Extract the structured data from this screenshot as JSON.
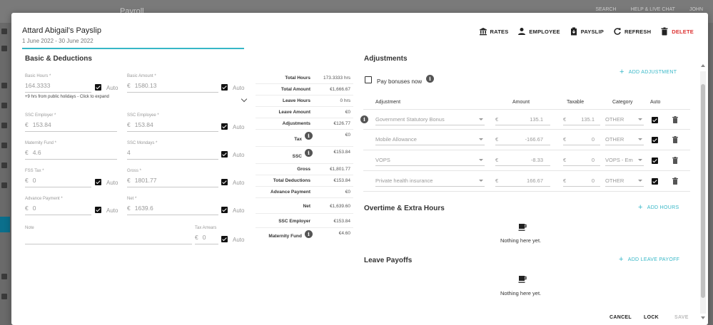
{
  "background": {
    "app_title": "Payroll",
    "top_right": [
      "SEARCH",
      "HELP & LIVE CHAT",
      "JOHN"
    ]
  },
  "header": {
    "title": "Attard Abigail's Payslip",
    "dates": "1 June 2022 - 30 June 2022"
  },
  "actions": {
    "rates": "RATES",
    "employee": "EMPLOYEE",
    "payslip": "PAYSLIP",
    "refresh": "REFRESH",
    "delete": "DELETE"
  },
  "basic": {
    "section_title": "Basic & Deductions",
    "auto_label": "Auto",
    "currency": "€",
    "basic_hours": {
      "label": "Basic Hours *",
      "value": "164.3333"
    },
    "basic_amount": {
      "label": "Basic Amount *",
      "value": "1580.13"
    },
    "hint": "+9 hrs from public holidays - Click to expand",
    "ssc_employer": {
      "label": "SSC Employer *",
      "value": "153.84"
    },
    "ssc_employee": {
      "label": "SSC Employee *",
      "value": "153.84"
    },
    "maternity_fund": {
      "label": "Maternity Fund *",
      "value": "4.6"
    },
    "ssc_mondays": {
      "label": "SSC Mondays *",
      "value": "4"
    },
    "fss_tax": {
      "label": "FSS Tax *",
      "value": "0"
    },
    "gross": {
      "label": "Gross *",
      "value": "1801.77"
    },
    "advance_payment": {
      "label": "Advance Payment *",
      "value": "0"
    },
    "net": {
      "label": "Net *",
      "value": "1639.6"
    },
    "note": {
      "label": "Note",
      "value": ""
    },
    "tax_arrears": {
      "label": "Tax Arrears",
      "value": "0"
    }
  },
  "summary": [
    {
      "key": "Total Hours",
      "value": "173.3333 hrs"
    },
    {
      "key": "Total Amount",
      "value": "€1,666.67"
    },
    {
      "key": "Leave Hours",
      "value": "0 hrs"
    },
    {
      "key": "Leave Amount",
      "value": "€0"
    },
    {
      "key": "Adjustments",
      "value": "€126.77"
    },
    {
      "key": "Tax",
      "value": "€0"
    },
    {
      "key": "SSC",
      "value": "€153.84"
    },
    {
      "key": "Gross",
      "value": "€1,801.77"
    },
    {
      "key": "Total Deductions",
      "value": "€153.84"
    },
    {
      "key": "Advance Payment",
      "value": "€0"
    },
    {
      "key": "Net",
      "value": "€1,639.60"
    },
    {
      "key": "SSC Employer",
      "value": "€153.84"
    },
    {
      "key": "Maternity Fund",
      "value": "€4.60"
    }
  ],
  "adjustments": {
    "section_title": "Adjustments",
    "pay_bonuses_label": "Pay bonuses now",
    "add_label": "ADD ADJUSTMENT",
    "columns": {
      "adjustment": "Adjustment",
      "amount": "Amount",
      "taxable": "Taxable",
      "category": "Category",
      "auto": "Auto"
    },
    "currency": "€",
    "rows": [
      {
        "name": "Government Statutory Bonus",
        "amount": "135.1",
        "taxable": "135.1",
        "category": "OTHER"
      },
      {
        "name": "Mobile Allowance",
        "amount": "-166.67",
        "taxable": "0",
        "category": "OTHER"
      },
      {
        "name": "VOPS",
        "amount": "-8.33",
        "taxable": "0",
        "category": "VOPS - Em"
      },
      {
        "name": "Private health insurance",
        "amount": "166.67",
        "taxable": "0",
        "category": "OTHER"
      }
    ]
  },
  "overtime": {
    "section_title": "Overtime & Extra Hours",
    "add_label": "ADD HOURS",
    "empty": "Nothing here yet."
  },
  "leave_payoffs": {
    "section_title": "Leave Payoffs",
    "add_label": "ADD LEAVE PAYOFF",
    "empty": "Nothing here yet."
  },
  "footer": {
    "cancel": "CANCEL",
    "lock": "LOCK",
    "save": "SAVE"
  },
  "colors": {
    "accent": "#37b7c7",
    "delete": "#dd3333"
  }
}
